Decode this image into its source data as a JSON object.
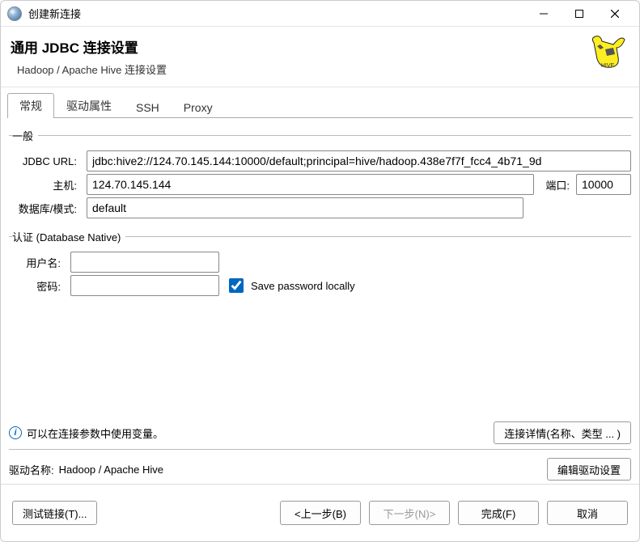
{
  "window": {
    "title": "创建新连接"
  },
  "header": {
    "title": "通用 JDBC 连接设置",
    "subtitle": "Hadoop / Apache Hive 连接设置"
  },
  "tabs": [
    {
      "label": "常规",
      "active": true
    },
    {
      "label": "驱动属性",
      "active": false
    },
    {
      "label": "SSH",
      "active": false
    },
    {
      "label": "Proxy",
      "active": false
    }
  ],
  "group_general": {
    "legend": "一般",
    "jdbc_url_label": "JDBC URL:",
    "jdbc_url_value": "jdbc:hive2://124.70.145.144:10000/default;principal=hive/hadoop.438e7f7f_fcc4_4b71_9d",
    "host_label": "主机:",
    "host_value": "124.70.145.144",
    "port_label": "端口:",
    "port_value": "10000",
    "db_label": "数据库/模式:",
    "db_value": "default"
  },
  "group_auth": {
    "legend": "认证 (Database Native)",
    "user_label": "用户名:",
    "user_value": "",
    "password_label": "密码:",
    "password_value": "",
    "save_pw_checked": true,
    "save_pw_label": "Save password locally"
  },
  "hint": {
    "text": "可以在连接参数中使用变量。",
    "details_button": "连接详情(名称、类型 ... )"
  },
  "driver": {
    "label": "驱动名称:",
    "value": "Hadoop / Apache Hive",
    "edit_button": "编辑驱动设置"
  },
  "footer": {
    "test": "测试链接(T)...",
    "back": "<上一步(B)",
    "next": "下一步(N)>",
    "finish": "完成(F)",
    "cancel": "取消"
  }
}
